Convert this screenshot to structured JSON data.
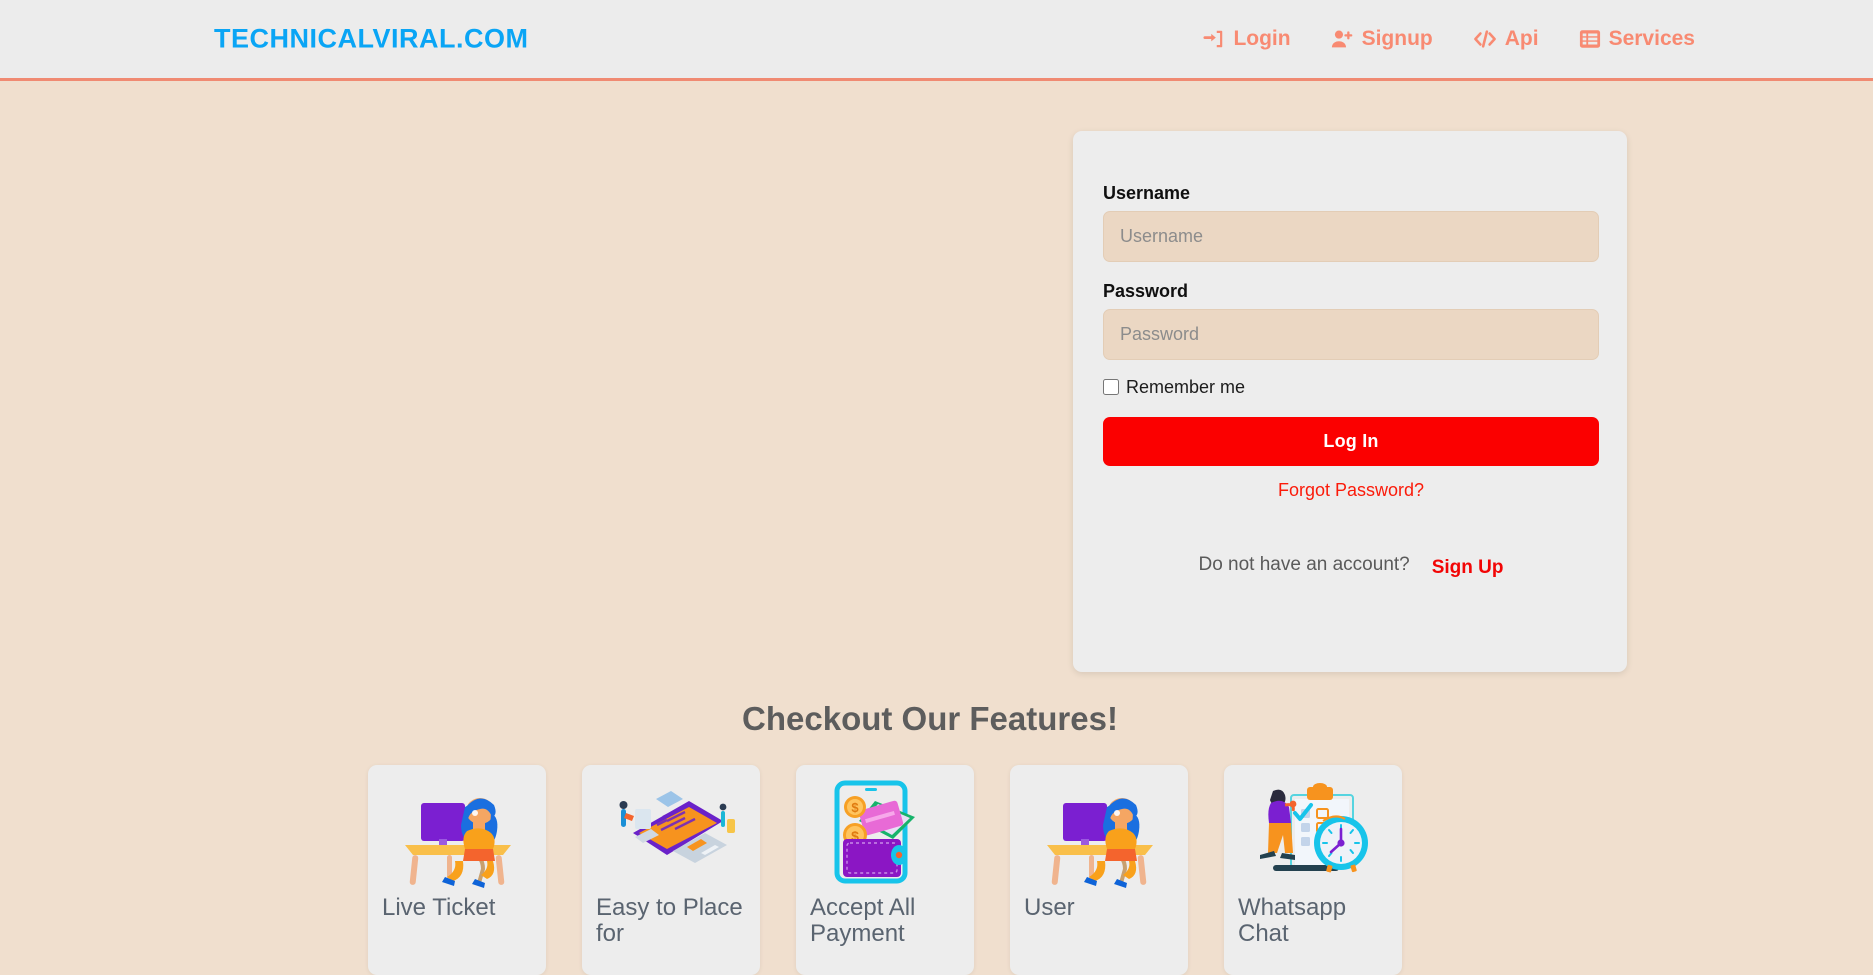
{
  "header": {
    "brand": "TECHNICALVIRAL.COM",
    "brand_color": "#0aa5f5",
    "nav_color": "#f88a72",
    "nav": [
      {
        "label": "Login",
        "icon": "sign-in-icon"
      },
      {
        "label": "Signup",
        "icon": "user-plus-icon"
      },
      {
        "label": "Api",
        "icon": "code-icon"
      },
      {
        "label": "Services",
        "icon": "list-table-icon"
      }
    ]
  },
  "login": {
    "username_label": "Username",
    "username_placeholder": "Username",
    "username_value": "",
    "password_label": "Password",
    "password_placeholder": "Password",
    "password_value": "",
    "remember_label": "Remember me",
    "remember_checked": false,
    "submit_label": "Log In",
    "submit_color": "#fb0000",
    "forgot_label": "Forgot Password?",
    "forgot_color": "#fb1b0a",
    "signup_question": "Do not have an account?",
    "signup_link": "Sign Up",
    "signup_link_color": "#f20505"
  },
  "features": {
    "heading": "Checkout Our Features!",
    "heading_color": "#5d5d5d",
    "cards": [
      {
        "title": "Live Ticket",
        "art": "woman-at-desk-illustration"
      },
      {
        "title": "Easy to Place for",
        "art": "phone-payment-illustration"
      },
      {
        "title": "Accept All Payment",
        "art": "wallet-phone-illustration"
      },
      {
        "title": "User",
        "art": "woman-at-desk-illustration"
      },
      {
        "title": "Whatsapp Chat",
        "art": "clipboard-clock-illustration"
      }
    ]
  },
  "theme": {
    "page_background": "#f0dfce",
    "header_background": "#ececec",
    "header_border": "#f08a72",
    "card_background": "#ededed",
    "input_background": "#ebd7c3"
  }
}
